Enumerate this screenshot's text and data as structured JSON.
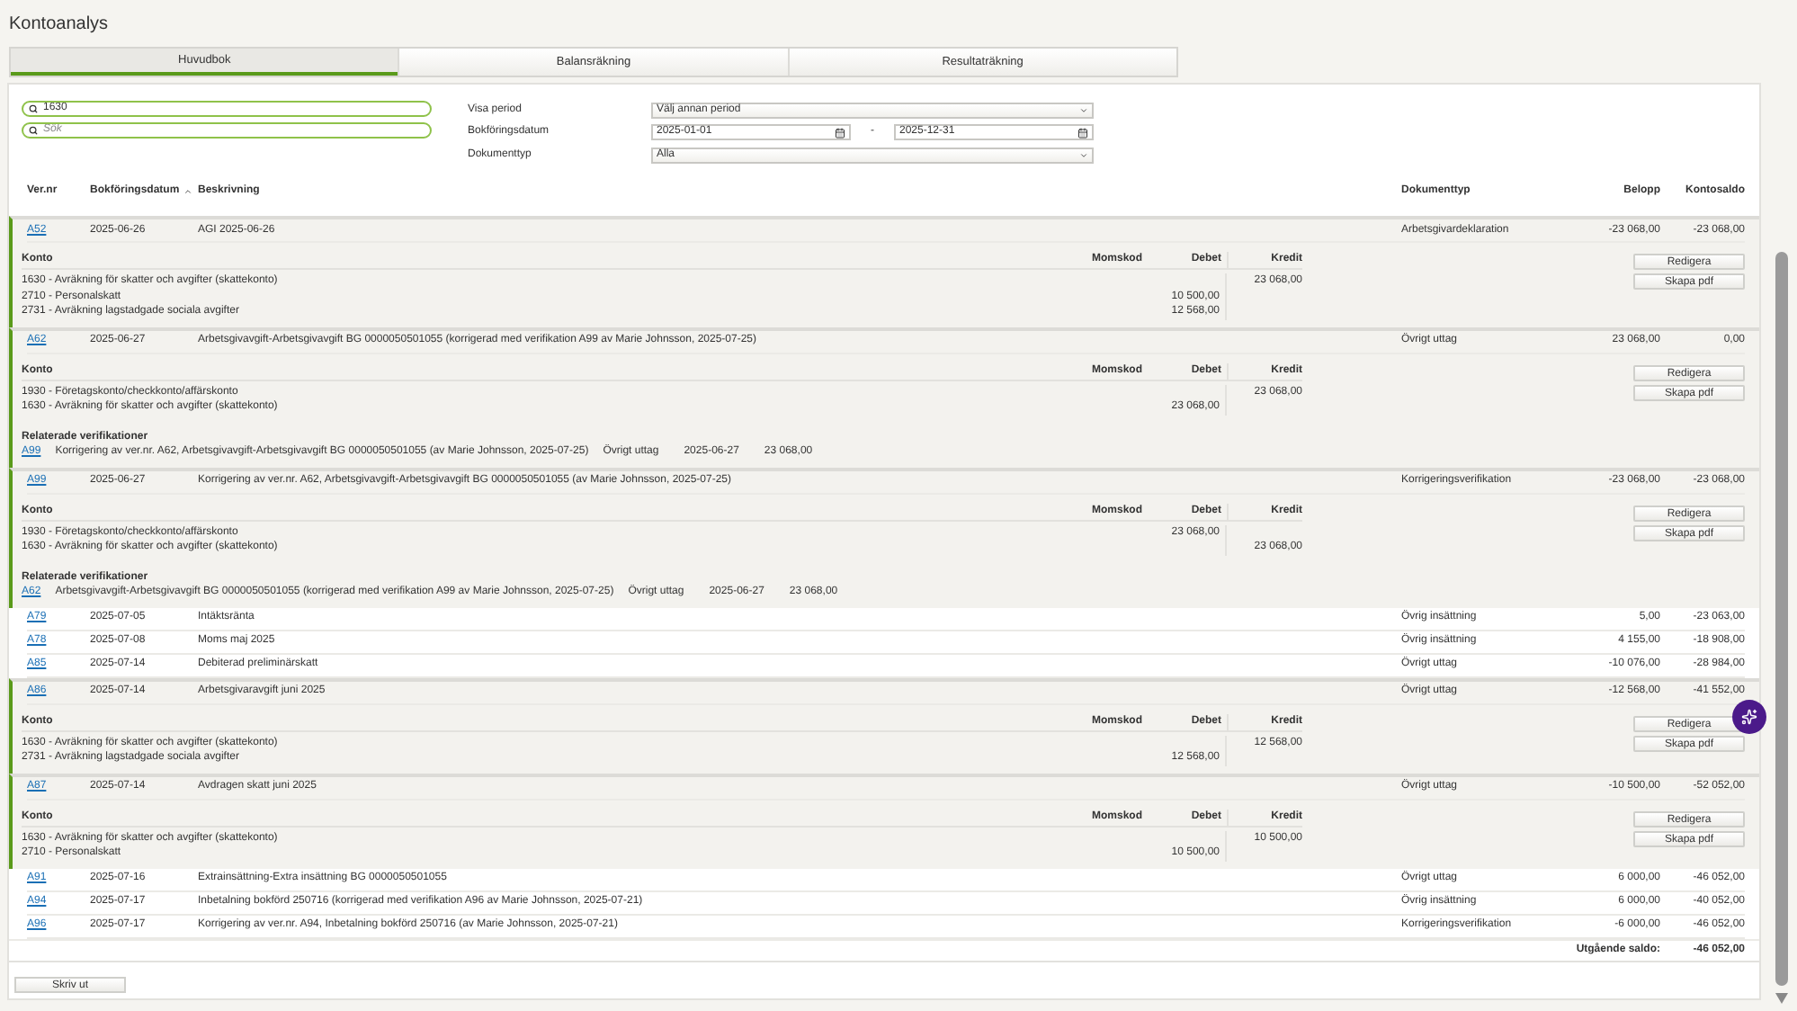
{
  "page": {
    "title": "Kontoanalys"
  },
  "tabs": [
    {
      "label": "Huvudbok",
      "selected": true
    },
    {
      "label": "Balansräkning",
      "selected": false
    },
    {
      "label": "Resultaträkning",
      "selected": false
    }
  ],
  "filters": {
    "searches": [
      {
        "value": "1630"
      },
      {
        "placeholder": "Sök"
      }
    ],
    "period": {
      "label": "Visa period",
      "value": "Välj annan period"
    },
    "date": {
      "label": "Bokföringsdatum",
      "from": "2025-01-01",
      "separator": "-",
      "to": "2025-12-31"
    },
    "doctype": {
      "label": "Dokumenttyp",
      "value": "Alla"
    }
  },
  "columns": [
    {
      "label": "Ver.nr",
      "sorted": false
    },
    {
      "label": "Bokföringsdatum",
      "sorted": true
    },
    {
      "label": "Beskrivning",
      "sorted": false
    },
    {
      "label": "Dokumenttyp",
      "sorted": false
    },
    {
      "label": "Belopp",
      "sorted": false
    },
    {
      "label": "Kontosaldo",
      "sorted": false
    }
  ],
  "rows": [
    {
      "ver": "A52",
      "date": "2025-06-26",
      "desc": "AGI 2025-06-26",
      "type": "Arbetsgivardeklaration",
      "amount": "-23 068,00",
      "balance": "-23 068,00",
      "expanded": true,
      "detail_headers": [
        "Konto",
        "Momskod",
        "Debet",
        "Kredit"
      ],
      "lines": [
        {
          "account": "1630 - Avräkning för skatter och avgifter (skattekonto)",
          "kredit": "23 068,00"
        },
        {
          "account": "2710 - Personalskatt",
          "debet": "10 500,00"
        },
        {
          "account": "2731 - Avräkning lagstadgade sociala avgifter",
          "debet": "12 568,00"
        }
      ],
      "actions": [
        "Redigera",
        "Skapa pdf"
      ]
    },
    {
      "ver": "A62",
      "date": "2025-06-27",
      "desc": "Arbetsgivavgift-Arbetsgivavgift BG 0000050501055 (korrigerad med verifikation A99 av Marie Johnsson, 2025-07-25)",
      "type": "Övrigt uttag",
      "amount": "23 068,00",
      "balance": "0,00",
      "expanded": true,
      "detail_headers": [
        "Konto",
        "Momskod",
        "Debet",
        "Kredit"
      ],
      "lines": [
        {
          "account": "1930 - Företagskonto/checkkonto/affärskonto",
          "kredit": "23 068,00"
        },
        {
          "account": "1630 - Avräkning för skatter och avgifter (skattekonto)",
          "debet": "23 068,00"
        }
      ],
      "actions": [
        "Redigera",
        "Skapa pdf"
      ],
      "related_title": "Relaterade verifikationer",
      "related": [
        {
          "ver": "A99",
          "desc": "Korrigering av ver.nr. A62, Arbetsgivavgift-Arbetsgivavgift BG 0000050501055 (av Marie Johnsson, 2025-07-25)",
          "type": "Övrigt uttag",
          "date": "2025-06-27",
          "amount": "23 068,00"
        }
      ]
    },
    {
      "ver": "A99",
      "date": "2025-06-27",
      "desc": "Korrigering av ver.nr. A62, Arbetsgivavgift-Arbetsgivavgift BG 0000050501055 (av Marie Johnsson, 2025-07-25)",
      "type": "Korrigeringsverifikation",
      "amount": "-23 068,00",
      "balance": "-23 068,00",
      "expanded": true,
      "detail_headers": [
        "Konto",
        "Momskod",
        "Debet",
        "Kredit"
      ],
      "lines": [
        {
          "account": "1930 - Företagskonto/checkkonto/affärskonto",
          "debet": "23 068,00"
        },
        {
          "account": "1630 - Avräkning för skatter och avgifter (skattekonto)",
          "kredit": "23 068,00"
        }
      ],
      "actions": [
        "Redigera",
        "Skapa pdf"
      ],
      "related_title": "Relaterade verifikationer",
      "related": [
        {
          "ver": "A62",
          "desc": "Arbetsgivavgift-Arbetsgivavgift BG 0000050501055 (korrigerad med verifikation A99 av Marie Johnsson, 2025-07-25)",
          "type": "Övrigt uttag",
          "date": "2025-06-27",
          "amount": "23 068,00"
        }
      ]
    },
    {
      "ver": "A79",
      "date": "2025-07-05",
      "desc": "Intäktsränta",
      "type": "Övrig insättning",
      "amount": "5,00",
      "balance": "-23 063,00",
      "expanded": false
    },
    {
      "ver": "A78",
      "date": "2025-07-08",
      "desc": "Moms maj 2025",
      "type": "Övrig insättning",
      "amount": "4 155,00",
      "balance": "-18 908,00",
      "expanded": false
    },
    {
      "ver": "A85",
      "date": "2025-07-14",
      "desc": "Debiterad preliminärskatt",
      "type": "Övrigt uttag",
      "amount": "-10 076,00",
      "balance": "-28 984,00",
      "expanded": false
    },
    {
      "ver": "A86",
      "date": "2025-07-14",
      "desc": "Arbetsgivaravgift juni 2025",
      "type": "Övrigt uttag",
      "amount": "-12 568,00",
      "balance": "-41 552,00",
      "expanded": true,
      "detail_headers": [
        "Konto",
        "Momskod",
        "Debet",
        "Kredit"
      ],
      "lines": [
        {
          "account": "1630 - Avräkning för skatter och avgifter (skattekonto)",
          "kredit": "12 568,00"
        },
        {
          "account": "2731 - Avräkning lagstadgade sociala avgifter",
          "debet": "12 568,00"
        }
      ],
      "actions": [
        "Redigera",
        "Skapa pdf"
      ]
    },
    {
      "ver": "A87",
      "date": "2025-07-14",
      "desc": "Avdragen skatt juni 2025",
      "type": "Övrigt uttag",
      "amount": "-10 500,00",
      "balance": "-52 052,00",
      "expanded": true,
      "detail_headers": [
        "Konto",
        "Momskod",
        "Debet",
        "Kredit"
      ],
      "lines": [
        {
          "account": "1630 - Avräkning för skatter och avgifter (skattekonto)",
          "kredit": "10 500,00"
        },
        {
          "account": "2710 - Personalskatt",
          "debet": "10 500,00"
        }
      ],
      "actions": [
        "Redigera",
        "Skapa pdf"
      ]
    },
    {
      "ver": "A91",
      "date": "2025-07-16",
      "desc": "Extrainsättning-Extra insättning BG 0000050501055",
      "type": "Övrigt uttag",
      "amount": "6 000,00",
      "balance": "-46 052,00",
      "expanded": false
    },
    {
      "ver": "A94",
      "date": "2025-07-17",
      "desc": "Inbetalning bokförd 250716 (korrigerad med verifikation A96 av Marie Johnsson, 2025-07-21)",
      "type": "Övrig insättning",
      "amount": "6 000,00",
      "balance": "-40 052,00",
      "expanded": false
    },
    {
      "ver": "A96",
      "date": "2025-07-17",
      "desc": "Korrigering av ver.nr. A94, Inbetalning bokförd 250716 (av Marie Johnsson, 2025-07-21)",
      "type": "Korrigeringsverifikation",
      "amount": "-6 000,00",
      "balance": "-46 052,00",
      "expanded": false
    }
  ],
  "closing": {
    "label": "Utgående saldo:",
    "value": "-46 052,00"
  },
  "print_button": "Skriv ut"
}
